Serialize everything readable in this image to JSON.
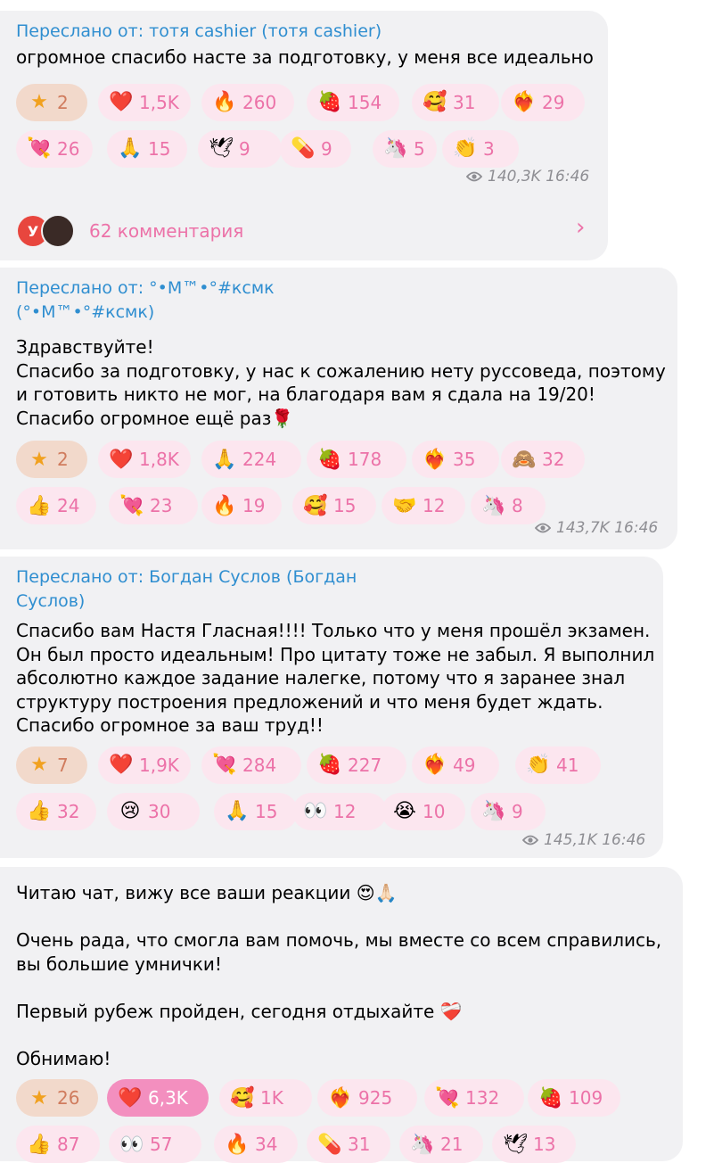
{
  "messages": [
    {
      "forwarded": "Переслано от: тотя cashier (тотя cashier)",
      "text": "огромное спасибо насте за подготовку, у меня все идеально",
      "reactions": [
        {
          "emoji": "★",
          "count": "2"
        },
        {
          "emoji": "❤️",
          "count": "1,5K"
        },
        {
          "emoji": "🔥",
          "count": "260"
        },
        {
          "emoji": "🍓",
          "count": "154"
        },
        {
          "emoji": "🥰",
          "count": "31"
        },
        {
          "emoji": "❤️‍🔥",
          "count": "29"
        },
        {
          "emoji": "💘",
          "count": "26"
        },
        {
          "emoji": "🙏",
          "count": "15"
        },
        {
          "emoji": "🕊",
          "count": "9"
        },
        {
          "emoji": "💊",
          "count": "9"
        },
        {
          "emoji": "🦄",
          "count": "5"
        },
        {
          "emoji": "👏",
          "count": "3"
        }
      ],
      "views": "140,3K",
      "time": "16:46",
      "comments": {
        "avatar_letter": "У",
        "label": "62 комментария"
      }
    },
    {
      "forwarded": "Переслано от: °•M™•°#ксмк\n(°•M™•°#ксмк)",
      "text": "Здравствуйте!\nСпасибо за подготовку, у нас к сожалению нету руссоведа, поэтому\nи готовить никто не мог, на благодаря вам я сдала на 19/20!\nСпасибо огромное ещё раз🌹",
      "reactions": [
        {
          "emoji": "★",
          "count": "2"
        },
        {
          "emoji": "❤️",
          "count": "1,8K"
        },
        {
          "emoji": "🙏",
          "count": "224"
        },
        {
          "emoji": "🍓",
          "count": "178"
        },
        {
          "emoji": "❤️‍🔥",
          "count": "35"
        },
        {
          "emoji": "🙈",
          "count": "32"
        },
        {
          "emoji": "👍",
          "count": "24"
        },
        {
          "emoji": "💘",
          "count": "23"
        },
        {
          "emoji": "🔥",
          "count": "19"
        },
        {
          "emoji": "🥰",
          "count": "15"
        },
        {
          "emoji": "🤝",
          "count": "12"
        },
        {
          "emoji": "🦄",
          "count": "8"
        }
      ],
      "views": "143,7K",
      "time": "16:46"
    },
    {
      "forwarded": "Переслано от: Богдан Суслов (Богдан\nСуслов)",
      "text": "Спасибо вам Настя Гласная!!!! Только что у меня прошёл экзамен.\nОн был просто идеальным! Про цитату тоже не забыл. Я выполнил\nабсолютно каждое задание налегке, потому что я заранее знал\nструктуру построения предложений и что меня будет ждать.\nСпасибо огромное за ваш труд!!",
      "reactions": [
        {
          "emoji": "★",
          "count": "7"
        },
        {
          "emoji": "❤️",
          "count": "1,9K"
        },
        {
          "emoji": "💘",
          "count": "284"
        },
        {
          "emoji": "🍓",
          "count": "227"
        },
        {
          "emoji": "❤️‍🔥",
          "count": "49"
        },
        {
          "emoji": "👏",
          "count": "41"
        },
        {
          "emoji": "👍",
          "count": "32"
        },
        {
          "emoji": "😢",
          "count": "30"
        },
        {
          "emoji": "🙏",
          "count": "15"
        },
        {
          "emoji": "👀",
          "count": "12"
        },
        {
          "emoji": "😭",
          "count": "10"
        },
        {
          "emoji": "🦄",
          "count": "9"
        }
      ],
      "views": "145,1K",
      "time": "16:46"
    },
    {
      "text": "Читаю чат, вижу все ваши реакции 😍🙏🏻\n\nОчень рада, что смогла вам помочь, мы вместе со всем справились,\nвы большие умнички!\n\nПервый рубеж пройден, сегодня отдыхайте ❤️‍🩹\n\nОбнимаю!",
      "reactions": [
        {
          "emoji": "★",
          "count": "26"
        },
        {
          "emoji": "❤️",
          "count": "6,3K"
        },
        {
          "emoji": "🥰",
          "count": "1K"
        },
        {
          "emoji": "❤️‍🔥",
          "count": "925"
        },
        {
          "emoji": "💘",
          "count": "132"
        },
        {
          "emoji": "🍓",
          "count": "109"
        },
        {
          "emoji": "👍",
          "count": "87"
        },
        {
          "emoji": "👀",
          "count": "57"
        },
        {
          "emoji": "🔥",
          "count": "34"
        },
        {
          "emoji": "💊",
          "count": "31"
        },
        {
          "emoji": "🦄",
          "count": "21"
        },
        {
          "emoji": "🕊",
          "count": "13"
        }
      ]
    }
  ]
}
